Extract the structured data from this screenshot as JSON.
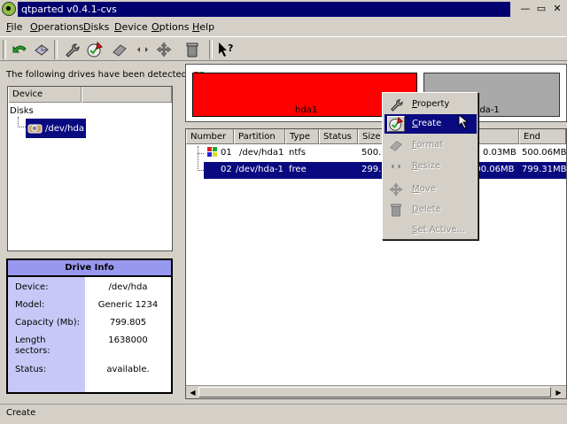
{
  "window": {
    "title": "qtparted v0.4.1-cvs",
    "controls": [
      "—",
      "▭",
      "✕"
    ]
  },
  "menu": [
    {
      "label": "File",
      "underline": "F",
      "rest": "ile"
    },
    {
      "label": "Operations",
      "underline": "O",
      "rest": "perations"
    },
    {
      "label": "Disks",
      "underline": "D",
      "rest": "isks"
    },
    {
      "label": "Device",
      "underline": "D",
      "rest": "evice"
    },
    {
      "label": "Options",
      "underline": "O",
      "rest": "ptions"
    },
    {
      "label": "Help",
      "underline": "H",
      "rest": "elp"
    }
  ],
  "toolbar": {
    "icons": [
      "undo-icon",
      "commit-icon",
      "property-icon",
      "create-icon",
      "format-icon",
      "resize-icon",
      "move-icon",
      "delete-icon",
      "whats-this-icon"
    ]
  },
  "left": {
    "detected_label": "The following drives have been detected:",
    "tree_header": "Device",
    "tree_root": "Disks",
    "tree_node": "/dev/hda"
  },
  "drive_info": {
    "title": "Drive Info",
    "rows": [
      {
        "label": "Device:",
        "value": "/dev/hda"
      },
      {
        "label": "Model:",
        "value": "Generic 1234"
      },
      {
        "label": "Capacity (Mb):",
        "value": "799.805"
      },
      {
        "label": "Length sectors:",
        "value": "1638000"
      },
      {
        "label": "Status:",
        "value": "available."
      }
    ]
  },
  "map": {
    "part1_label": "hda1",
    "part2_label": "hda-1",
    "colors": {
      "part1": "#ff0000",
      "part2": "#a9a9a9"
    }
  },
  "table": {
    "columns": [
      "Number",
      "Partition",
      "Type",
      "Status",
      "Size",
      "Start",
      "End"
    ],
    "rows": [
      {
        "number": "01",
        "partition": "/dev/hda1",
        "type": "ntfs",
        "status": "",
        "size": "500.0",
        "start": "0.03MB",
        "end": "500.06MB"
      },
      {
        "number": "02",
        "partition": "/dev/hda-1",
        "type": "free",
        "status": "",
        "size": "299.2",
        "start": "500.06MB",
        "end": "799.31MB"
      }
    ]
  },
  "context_menu": {
    "items": [
      {
        "label": "Property",
        "underline": "P",
        "rest": "roperty",
        "icon": "wrench-icon",
        "enabled": true
      },
      {
        "label": "Create",
        "underline": "C",
        "rest": "reate",
        "icon": "create-icon",
        "enabled": true,
        "active": true
      },
      {
        "label": "Format",
        "underline": "F",
        "rest": "ormat",
        "icon": "eraser-icon",
        "enabled": false
      },
      {
        "label": "Resize",
        "underline": "R",
        "rest": "esize",
        "icon": "resize-icon",
        "enabled": false
      },
      {
        "label": "Move",
        "underline": "M",
        "rest": "ove",
        "icon": "move-icon",
        "enabled": false
      },
      {
        "label": "Delete",
        "underline": "D",
        "rest": "elete",
        "icon": "trash-icon",
        "enabled": false
      },
      {
        "label": "Set Active...",
        "underline": "S",
        "rest": "et Active...",
        "icon": "",
        "enabled": false
      }
    ]
  },
  "status": {
    "text": "Create"
  },
  "colors": {
    "selection": "#0a0a80",
    "title_bar": "#00006e",
    "drive_info_header": "#9898f0"
  }
}
